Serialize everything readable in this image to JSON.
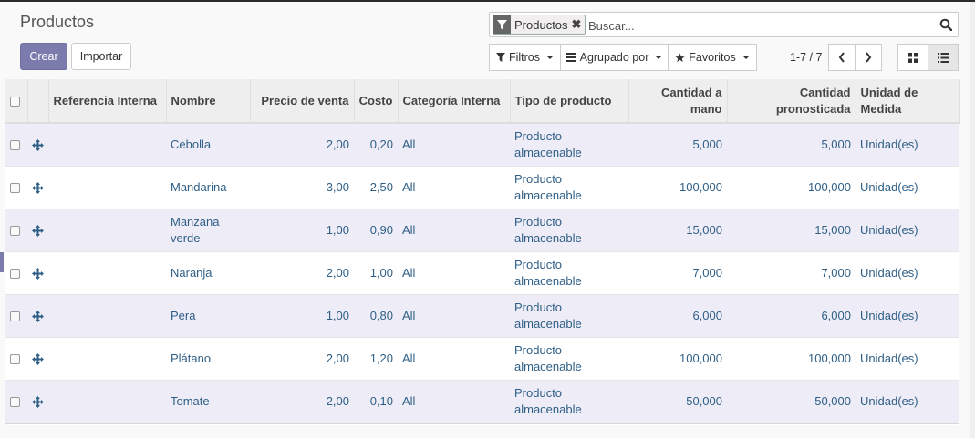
{
  "control_panel": {
    "title": "Productos",
    "create_label": "Crear",
    "import_label": "Importar"
  },
  "search": {
    "facet_label": "Productos",
    "facet_icon": "filter-icon",
    "placeholder": "Buscar..."
  },
  "filters": {
    "filters_label": "Filtros",
    "group_by_label": "Agrupado por",
    "favorites_label": "Favoritos"
  },
  "pager": {
    "value": "1-7 / 7"
  },
  "table": {
    "headers": {
      "ref": "Referencia Interna",
      "name": "Nombre",
      "price": "Precio de venta",
      "cost": "Costo",
      "category": "Categoría Interna",
      "type": "Tipo de producto",
      "qty": "Cantidad a mano",
      "forecast": "Cantidad pronosticada",
      "uom": "Unidad de Medida"
    },
    "rows": [
      {
        "ref": "",
        "name": "Cebolla",
        "price": "2,00",
        "cost": "0,20",
        "category": "All",
        "type": "Producto almacenable",
        "qty": "5,000",
        "forecast": "5,000",
        "uom": "Unidad(es)"
      },
      {
        "ref": "",
        "name": "Mandarina",
        "price": "3,00",
        "cost": "2,50",
        "category": "All",
        "type": "Producto almacenable",
        "qty": "100,000",
        "forecast": "100,000",
        "uom": "Unidad(es)"
      },
      {
        "ref": "",
        "name": "Manzana verde",
        "price": "1,00",
        "cost": "0,90",
        "category": "All",
        "type": "Producto almacenable",
        "qty": "15,000",
        "forecast": "15,000",
        "uom": "Unidad(es)"
      },
      {
        "ref": "",
        "name": "Naranja",
        "price": "2,00",
        "cost": "1,00",
        "category": "All",
        "type": "Producto almacenable",
        "qty": "7,000",
        "forecast": "7,000",
        "uom": "Unidad(es)"
      },
      {
        "ref": "",
        "name": "Pera",
        "price": "1,00",
        "cost": "0,80",
        "category": "All",
        "type": "Producto almacenable",
        "qty": "6,000",
        "forecast": "6,000",
        "uom": "Unidad(es)"
      },
      {
        "ref": "",
        "name": "Plátano",
        "price": "2,00",
        "cost": "1,20",
        "category": "All",
        "type": "Producto almacenable",
        "qty": "100,000",
        "forecast": "100,000",
        "uom": "Unidad(es)"
      },
      {
        "ref": "",
        "name": "Tomate",
        "price": "2,00",
        "cost": "0,10",
        "category": "All",
        "type": "Producto almacenable",
        "qty": "50,000",
        "forecast": "50,000",
        "uom": "Unidad(es)"
      }
    ]
  },
  "colors": {
    "primary": "#7c7bad",
    "link": "#2f5f86",
    "odd_row": "#eeedf7"
  }
}
